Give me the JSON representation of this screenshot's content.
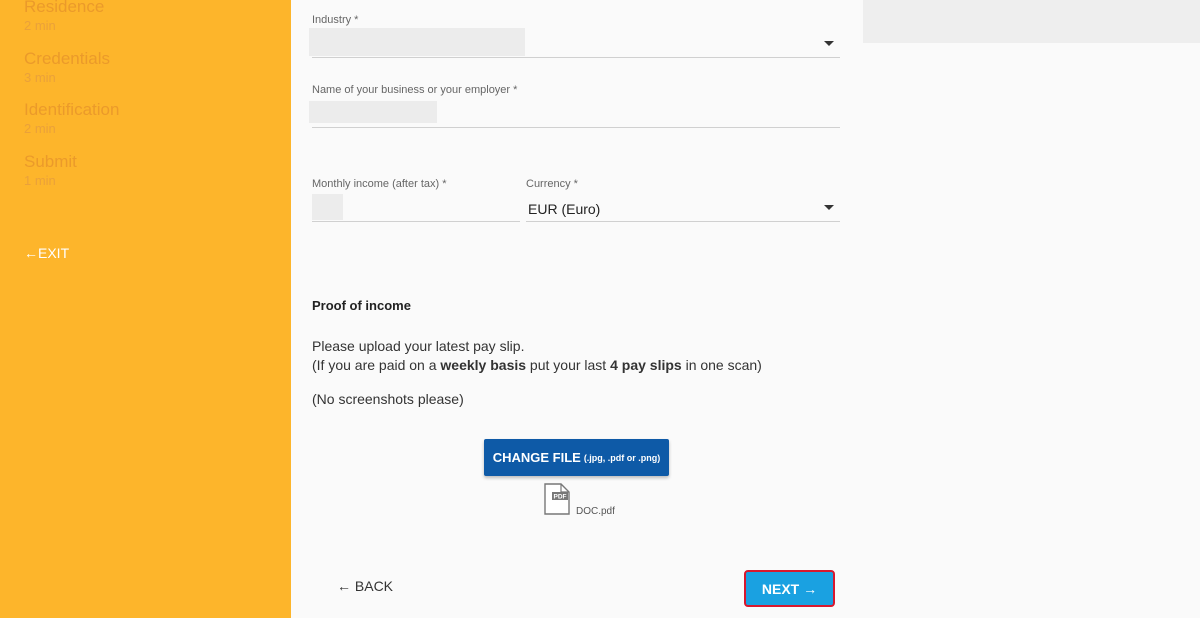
{
  "sidebar": {
    "steps": [
      {
        "title": "Residence",
        "time": "2 min"
      },
      {
        "title": "Credentials",
        "time": "3 min"
      },
      {
        "title": "Identification",
        "time": "2 min"
      },
      {
        "title": "Submit",
        "time": "1 min"
      }
    ],
    "exit_label": "←EXIT"
  },
  "form": {
    "industry_label": "Industry *",
    "business_label": "Name of your business or your employer *",
    "income_label": "Monthly income (after tax) *",
    "currency_label": "Currency *",
    "currency_value": "EUR (Euro)"
  },
  "proof": {
    "title": "Proof of income",
    "line1": "Please upload your latest pay slip.",
    "line2_pre": "(If you are paid on a ",
    "line2_bold1": "weekly basis",
    "line2_mid": " put your last ",
    "line2_bold2": "4 pay slips",
    "line2_post": " in one scan)",
    "line3": "(No screenshots please)",
    "upload_label": "CHANGE FILE",
    "upload_hint": "(.jpg, .pdf or .png)",
    "file_name": "DOC.pdf",
    "file_icon_text": "PDF"
  },
  "nav": {
    "back_label": "← BACK",
    "next_label": "NEXT →"
  },
  "colors": {
    "sidebar": "#fdb52b",
    "primary": "#0e5aa7",
    "next": "#1aa1e1",
    "highlight": "#d8182e"
  }
}
